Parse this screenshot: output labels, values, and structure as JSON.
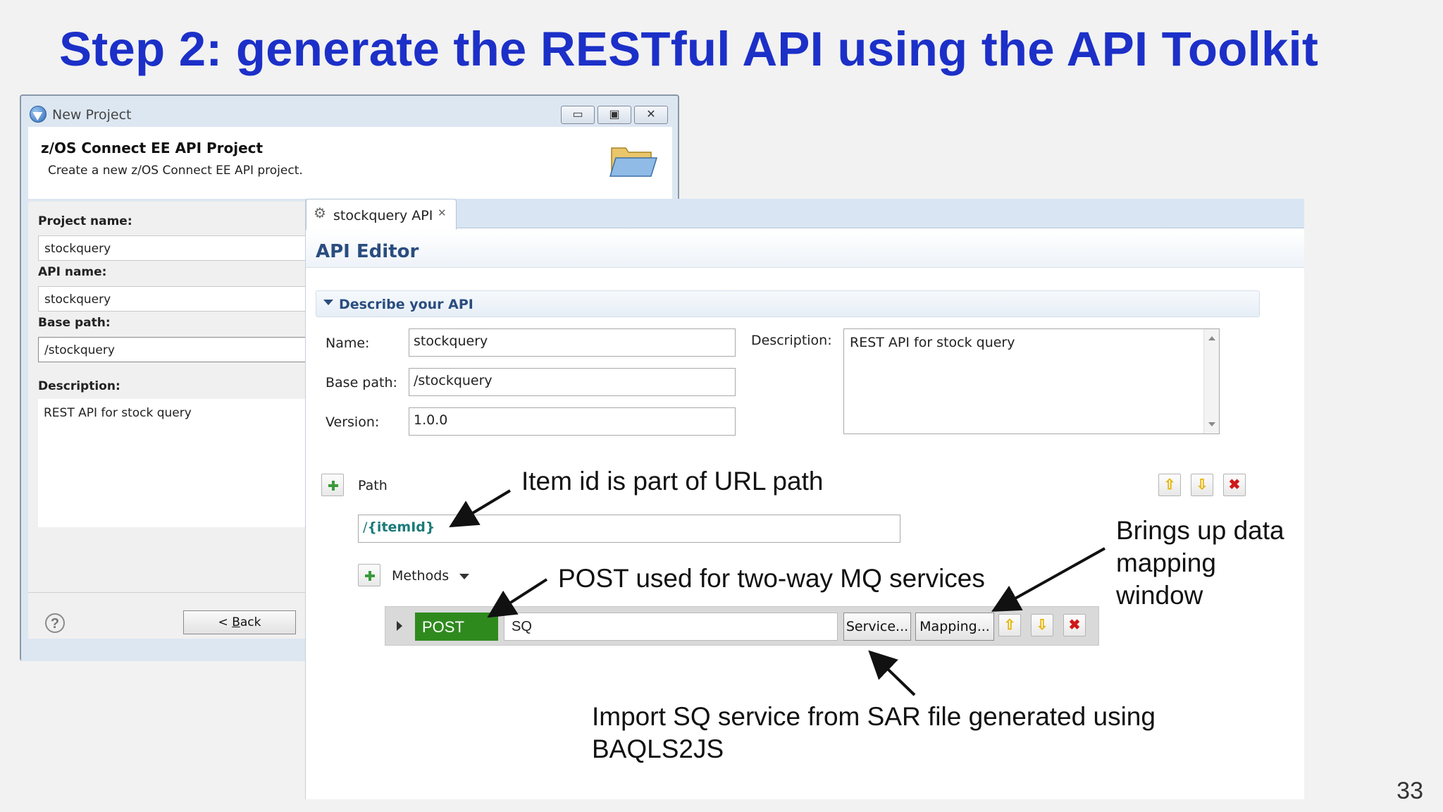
{
  "slide": {
    "title": "Step 2: generate the RESTful API using the API Toolkit",
    "page_number": "33"
  },
  "dialog": {
    "title": "New Project",
    "window_buttons": {
      "minimize": "▭",
      "maximize": "▣",
      "close": "✕"
    },
    "heading": "z/OS Connect EE API Project",
    "subheading": "Create a new z/OS Connect EE API project.",
    "fields": {
      "project_name_label": "Project name:",
      "project_name_value": "stockquery",
      "api_name_label": "API name:",
      "api_name_value": "stockquery",
      "base_path_label": "Base path:",
      "base_path_value": "/stockquery",
      "description_label": "Description:",
      "description_value": "REST API for stock query"
    },
    "help_glyph": "?",
    "back_button": {
      "prefix": "< ",
      "underlined": "B",
      "rest": "ack"
    }
  },
  "editor": {
    "tab_label": "stockquery API",
    "tab_close": "✕",
    "heading": "API Editor",
    "section_title": "Describe your API",
    "name_label": "Name:",
    "name_value": "stockquery",
    "base_path_label": "Base path:",
    "base_path_value": "/stockquery",
    "version_label": "Version:",
    "version_value": "1.0.0",
    "description_label": "Description:",
    "description_value": "REST API for stock query",
    "path_label": "Path",
    "path_prefix": "/",
    "path_value": "{itemId}",
    "methods_label": "Methods",
    "method": {
      "verb": "POST",
      "service_name": "SQ",
      "service_button": "Service...",
      "mapping_button": "Mapping..."
    },
    "icons": {
      "up": "⇧",
      "down": "⇩",
      "delete": "✖"
    },
    "colors": {
      "post_badge": "#2f8a1e",
      "heading": "#2a4d7f",
      "delete": "#d01818",
      "move": "#e8b400"
    }
  },
  "annotations": {
    "path_note": "Item id is part of URL path",
    "post_note": "POST used for two-way MQ services",
    "mapping_note": "Brings up data mapping window",
    "import_note": "Import SQ service from SAR file generated using BAQLS2JS"
  },
  "colors": {
    "title": "#1c30c8"
  }
}
